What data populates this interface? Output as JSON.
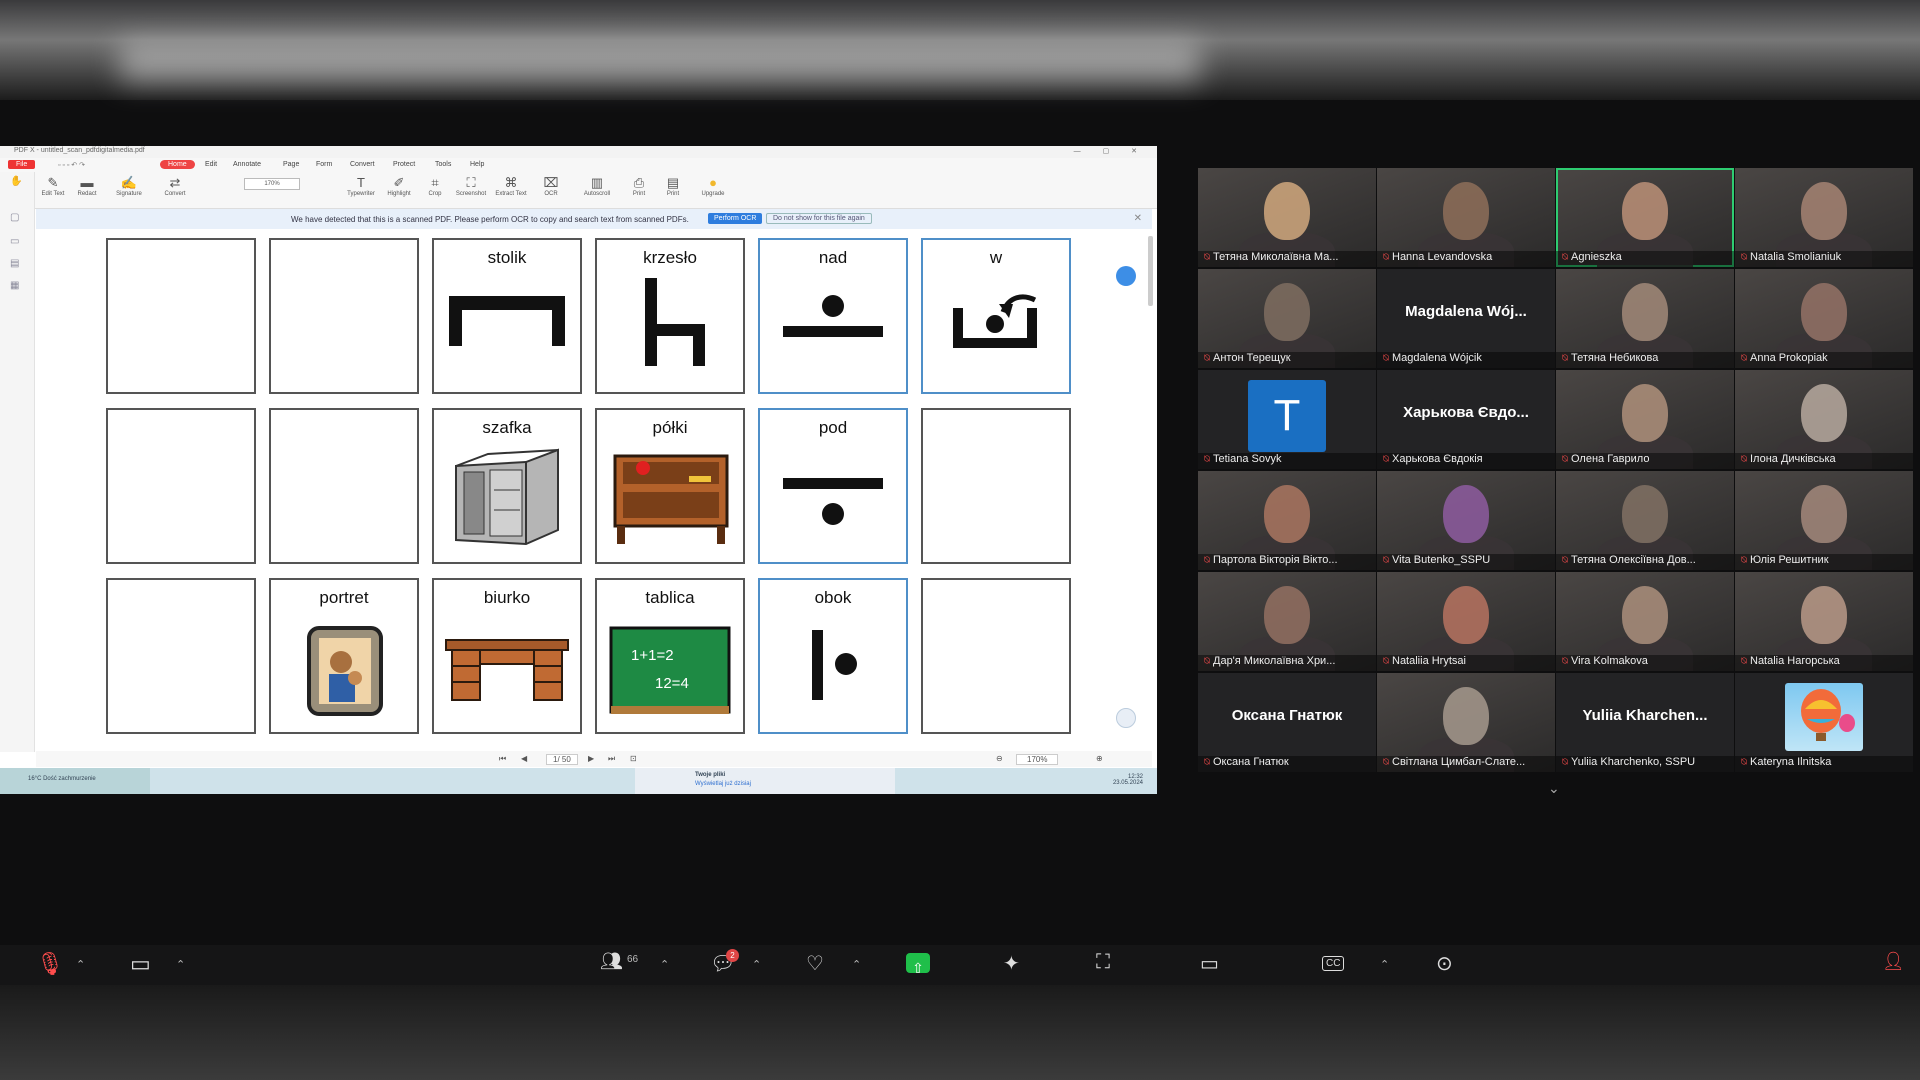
{
  "pdf_app": {
    "window_title": "PDF X - untitled_scan_pdfdigitalmedia.pdf",
    "menu": [
      "File",
      "Home",
      "Edit",
      "Annotate",
      "Page",
      "Form",
      "Convert",
      "Protect",
      "Tools",
      "Help"
    ],
    "zoom": "170%",
    "tools": [
      "Edit Text",
      "Redact",
      "Signature",
      "Convert",
      "Typewriter",
      "Highlight",
      "Crop",
      "Screenshot",
      "Extract Text",
      "OCR",
      "Autoscroll",
      "Print",
      "Print",
      "Upgrade"
    ],
    "ocr_notice": {
      "text": "We have detected that this is a scanned PDF. Please perform OCR to copy and search text from scanned PDFs.",
      "button": "Perform OCR",
      "dismiss": "Do not show for this file again"
    },
    "page_indicator": "1/ 50",
    "bottom_zoom": "170%",
    "taskbar": {
      "weather": "16°C Dość zachmurzenie",
      "notification_title": "Twoje pliki",
      "notification_sub": "Wyświetlaj już dzisiaj",
      "time": "12:32",
      "date": "23.05.2024"
    }
  },
  "cards": [
    {
      "id": "r1c1",
      "label": "",
      "style": "dark"
    },
    {
      "id": "r1c2",
      "label": "",
      "style": "dark"
    },
    {
      "id": "r1c3",
      "label": "stolik",
      "style": "dark",
      "icon": "table-symbol-icon"
    },
    {
      "id": "r1c4",
      "label": "krzesło",
      "style": "dark",
      "icon": "chair-symbol-icon"
    },
    {
      "id": "r1c5",
      "label": "nad",
      "style": "blue",
      "icon": "above-symbol-icon"
    },
    {
      "id": "r1c6",
      "label": "w",
      "style": "blue",
      "icon": "inside-symbol-icon"
    },
    {
      "id": "r2c1",
      "label": "",
      "style": "dark"
    },
    {
      "id": "r2c2",
      "label": "",
      "style": "dark"
    },
    {
      "id": "r2c3",
      "label": "szafka",
      "style": "dark",
      "icon": "cabinet-icon"
    },
    {
      "id": "r2c4",
      "label": "półki",
      "style": "dark",
      "icon": "shelves-icon"
    },
    {
      "id": "r2c5",
      "label": "pod",
      "style": "blue",
      "icon": "below-symbol-icon"
    },
    {
      "id": "r2c6",
      "label": "",
      "style": "dark"
    },
    {
      "id": "r3c1",
      "label": "",
      "style": "dark"
    },
    {
      "id": "r3c2",
      "label": "portret",
      "style": "dark",
      "icon": "portrait-icon"
    },
    {
      "id": "r3c3",
      "label": "biurko",
      "style": "dark",
      "icon": "desk-icon"
    },
    {
      "id": "r3c4",
      "label": "tablica",
      "style": "dark",
      "icon": "blackboard-icon"
    },
    {
      "id": "r3c5",
      "label": "obok",
      "style": "blue",
      "icon": "beside-symbol-icon"
    },
    {
      "id": "r3c6",
      "label": "",
      "style": "dark"
    }
  ],
  "blackboard_text": [
    "1+1=2",
    "12=4"
  ],
  "participants": [
    {
      "name": "Тетяна Миколаївна Ма...",
      "type": "video",
      "tone": "#c9a27a"
    },
    {
      "name": "Hanna Levandovska",
      "type": "video",
      "tone": "#8a6b58"
    },
    {
      "name": "Agnieszka",
      "type": "video",
      "tone": "#b58c74",
      "speaking": true
    },
    {
      "name": "Natalia Smolianiuk",
      "type": "video",
      "tone": "#a08070"
    },
    {
      "name": "Антон Терещук",
      "type": "video",
      "tone": "#7b6a5e"
    },
    {
      "name": "Magdalena Wójcik",
      "type": "name",
      "display": "Magdalena Wój..."
    },
    {
      "name": "Тетяна Небикова",
      "type": "video",
      "tone": "#9c8576"
    },
    {
      "name": "Anna Prokopiak",
      "type": "video",
      "tone": "#8f6f64"
    },
    {
      "name": "Tetiana Sovyk",
      "type": "avatar",
      "letter": "T"
    },
    {
      "name": "Харькова Євдокія",
      "type": "name",
      "display": "Харькова Євдо..."
    },
    {
      "name": "Олена Гаврило",
      "type": "video",
      "tone": "#a98c78"
    },
    {
      "name": "Ілона Дичківська",
      "type": "video",
      "tone": "#b0a399"
    },
    {
      "name": "Партола Вікторія Вікто...",
      "type": "video",
      "tone": "#a4725e"
    },
    {
      "name": "Vita Butenko_SSPU",
      "type": "video",
      "tone": "#8a5a9a"
    },
    {
      "name": "Тетяна Олексіївна Дов...",
      "type": "video",
      "tone": "#7d6e62"
    },
    {
      "name": "Юлія Решитник",
      "type": "video",
      "tone": "#9d8478"
    },
    {
      "name": "Дар'я Миколаївна Хри...",
      "type": "video",
      "tone": "#8e6d5f"
    },
    {
      "name": "Nataliia Hrytsai",
      "type": "video",
      "tone": "#b0705e"
    },
    {
      "name": "Vira Kolmakova",
      "type": "video",
      "tone": "#a58b79"
    },
    {
      "name": "Natalia Нагорська",
      "type": "video",
      "tone": "#b29584"
    },
    {
      "name": "Оксана Гнатюк",
      "type": "name",
      "display": "Оксана Гнатюк"
    },
    {
      "name": "Світлана Цимбал-Слате...",
      "type": "video",
      "tone": "#a09488"
    },
    {
      "name": "Yuliia Kharchenko, SSPU",
      "type": "name",
      "display": "Yuliia Kharchen..."
    },
    {
      "name": "Kateryna Ilnitska",
      "type": "balloon"
    }
  ],
  "controls": {
    "participants_count": "66",
    "chat_badge": "2"
  }
}
